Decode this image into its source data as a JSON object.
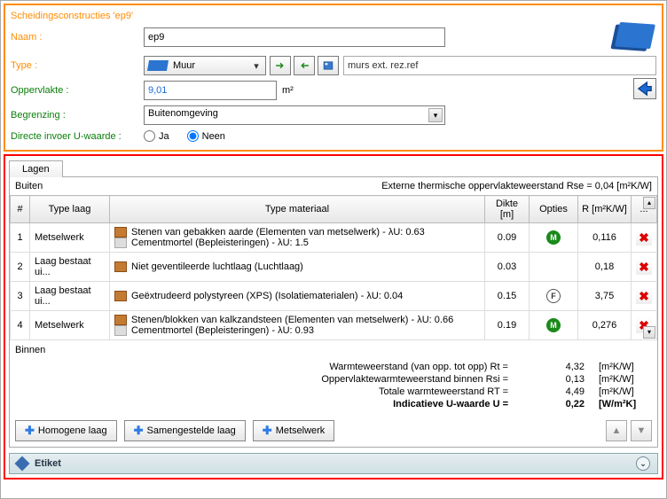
{
  "top": {
    "title": "Scheidingsconstructies 'ep9'",
    "name_label": "Naam :",
    "name_value": "ep9",
    "type_label": "Type :",
    "type_value": "Muur",
    "ref_text": "murs ext. rez.ref",
    "opp_label": "Oppervlakte :",
    "opp_value": "9,01",
    "opp_unit": "m²",
    "begrenzing_label": "Begrenzing  :",
    "begrenzing_value": "Buitenomgeving",
    "directe_label": "Directe invoer U-waarde :",
    "ja": "Ja",
    "neen": "Neen"
  },
  "mid": {
    "tab": "Lagen",
    "buiten": "Buiten",
    "buiten_right": "Externe thermische oppervlakteweerstand  Rse = 0,04    [m²K/W]",
    "headers": {
      "num": "#",
      "type_laag": "Type laag",
      "type_mat": "Type materiaal",
      "dikte": "Dikte [m]",
      "opties": "Opties",
      "r": "R [m²K/W]",
      "more": "..."
    },
    "rows": [
      {
        "n": "1",
        "type": "Metselwerk",
        "mat1": "Stenen van gebakken aarde (Elementen van metselwerk) - λU: 0.63",
        "mat2": "Cementmortel (Bepleisteringen) - λU: 1.5",
        "dikte": "0.09",
        "opt": "M",
        "r": "0,116"
      },
      {
        "n": "2",
        "type": "Laag bestaat ui...",
        "mat1": "Niet geventileerde luchtlaag (Luchtlaag)",
        "dikte": "0.03",
        "opt": "",
        "r": "0,18"
      },
      {
        "n": "3",
        "type": "Laag bestaat ui...",
        "mat1": "Geëxtrudeerd polystyreen (XPS) (Isolatiematerialen) - λU: 0.04",
        "dikte": "0.15",
        "opt": "F",
        "r": "3,75"
      },
      {
        "n": "4",
        "type": "Metselwerk",
        "mat1": "Stenen/blokken van kalkzandsteen (Elementen van metselwerk) - λU: 0.66",
        "mat2": "Cementmortel (Bepleisteringen) - λU: 0.93",
        "dikte": "0.19",
        "opt": "M",
        "r": "0,276"
      }
    ],
    "binnen": "Binnen",
    "summary": [
      {
        "label": "Warmteweerstand (van opp. tot opp)",
        "key": "Rt =",
        "val": "4,32",
        "unit": "[m²K/W]"
      },
      {
        "label": "Oppervlaktewarmteweerstand binnen",
        "key": "Rsi =",
        "val": "0,13",
        "unit": "[m²K/W]"
      },
      {
        "label": "Totale warmteweerstand",
        "key": "RT =",
        "val": "4,49",
        "unit": "[m²K/W]"
      },
      {
        "label": "Indicatieve U-waarde",
        "key": "U  =",
        "val": "0,22",
        "unit": "[W/m²K]",
        "bold": true
      }
    ],
    "btn_homogene": "Homogene laag",
    "btn_samen": "Samengestelde laag",
    "btn_metsel": "Metselwerk",
    "etiket": "Etiket"
  }
}
